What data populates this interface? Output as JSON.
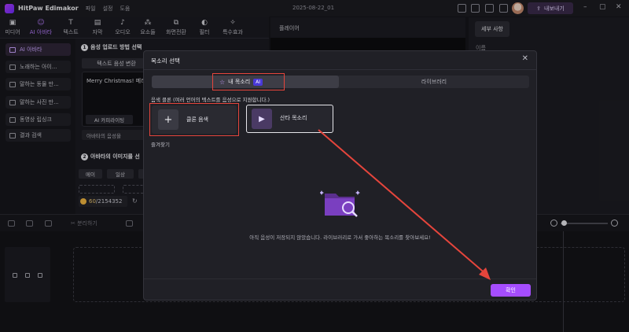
{
  "titlebar": {
    "app_name": "HitPaw Edimakor",
    "menu": [
      "파일",
      "설정",
      "도움"
    ],
    "doc_title": "2025-08-22_01",
    "export_label": "내보내기"
  },
  "tool_tabs": [
    {
      "label": "미디어",
      "glyph": "▣"
    },
    {
      "label": "AI 아바타",
      "glyph": "☺"
    },
    {
      "label": "텍스트",
      "glyph": "T"
    },
    {
      "label": "자막",
      "glyph": "▤"
    },
    {
      "label": "오디오",
      "glyph": "♪"
    },
    {
      "label": "요소들",
      "glyph": "⁂"
    },
    {
      "label": "화면전환",
      "glyph": "⧉"
    },
    {
      "label": "필터",
      "glyph": "◐"
    },
    {
      "label": "특수효과",
      "glyph": "✧"
    }
  ],
  "sidebar": {
    "items": [
      {
        "label": "AI 아바타"
      },
      {
        "label": "노래하는 아이..."
      },
      {
        "label": "말하는 동물 만..."
      },
      {
        "label": "말하는 사진 만..."
      },
      {
        "label": "동영상 립싱크"
      },
      {
        "label": "결과 검색"
      }
    ]
  },
  "avatar_panel": {
    "step1_num": "1",
    "step1": "음성 업로드 방법 선택",
    "tts_tab": "텍스트 음성 변환",
    "text_value": "Merry Christmas! 메리",
    "ai_copy": "AI 카피라이팅",
    "avatar_voice": "아바타의 음성을",
    "step2_num": "2",
    "step2": "아바타의 이미지를 선",
    "chips": [
      "메이",
      "일상"
    ],
    "credit_used": "60",
    "credit_total": "/2154352"
  },
  "player": {
    "title": "플레이어"
  },
  "right_panel": {
    "tab": "세부 사항",
    "label": "이름"
  },
  "timeline": {
    "split_label": "분리하기"
  },
  "modal": {
    "title": "목소리 선택",
    "close": "✕",
    "tab_mine": "내 목소리",
    "ai_badge": "AI",
    "tab_library": "라이브러리",
    "clone_desc": "음색 클론 (여러 언어의 텍스트를 음성으로 지원합니다.)",
    "clone_plus": "+",
    "clone_label": "클론 음색",
    "voice_label": "산타 목소리",
    "favorites_label": "즐겨찾기",
    "empty_text": "아직 음성이 저장되지 않았습니다. 라이브러리로 가서 좋아하는 목소리를 찾아보세요!",
    "confirm_label": "확인"
  },
  "colors": {
    "accent": "#a54dff",
    "annotation": "#e5453c"
  }
}
